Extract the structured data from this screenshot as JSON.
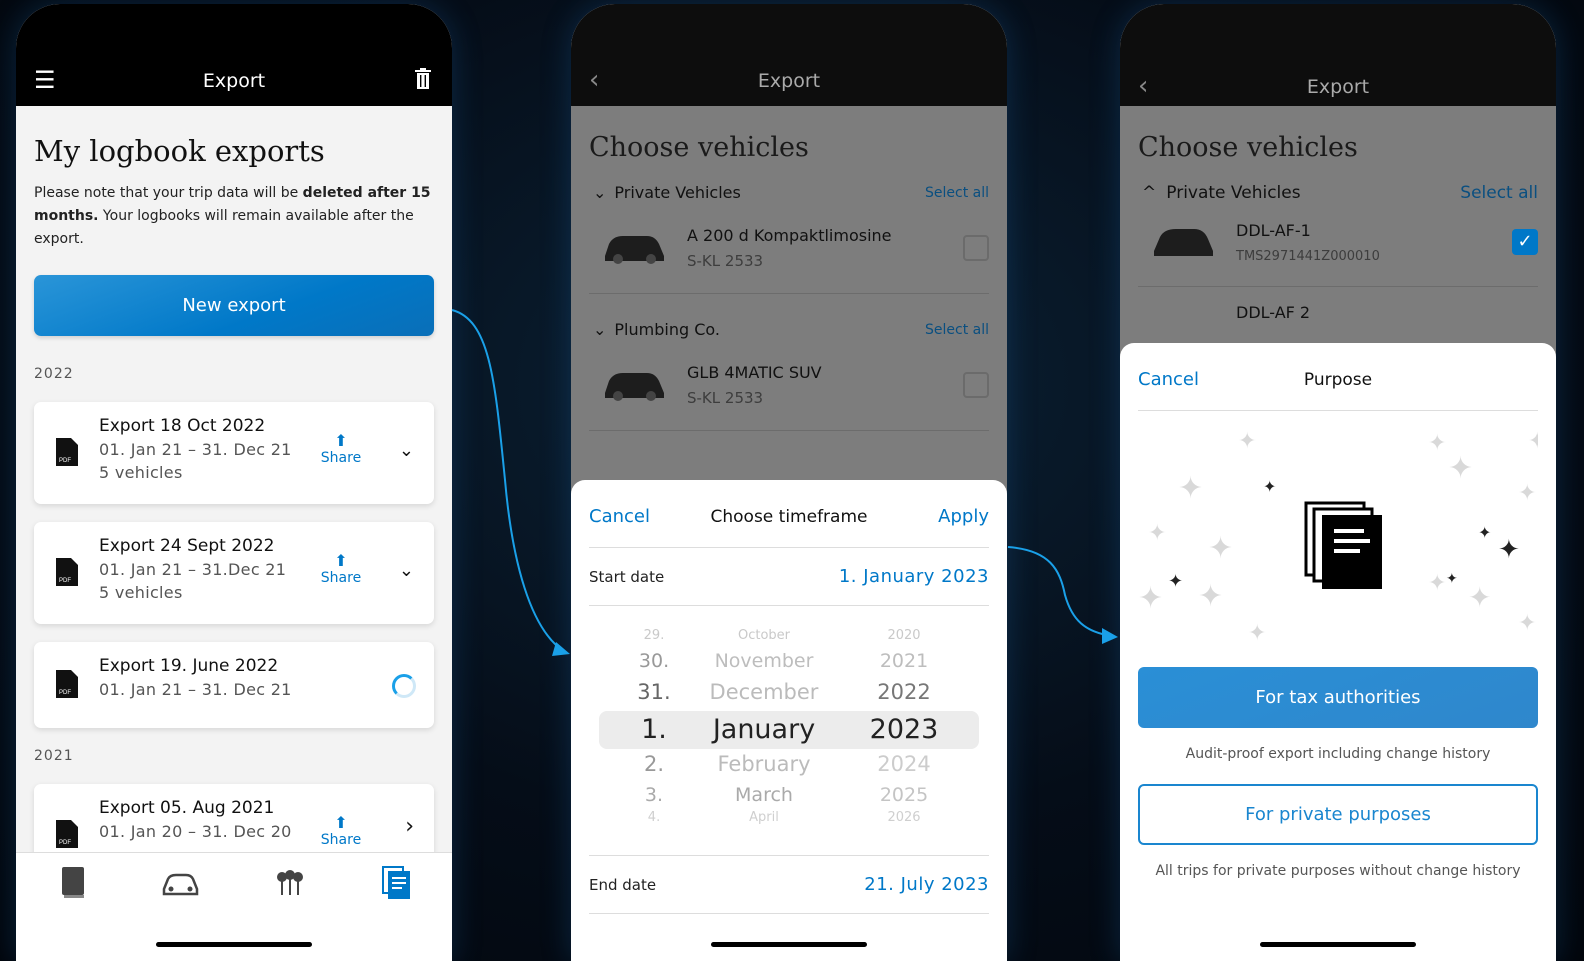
{
  "screen1": {
    "header_title": "Export",
    "page_title": "My logbook exports",
    "note_part1": "Please note that your trip data will be ",
    "note_bold": "deleted after 15 months.",
    "note_part2": " Your logbooks will remain available after the export.",
    "new_export_label": "New export",
    "year_2022": "2022",
    "year_2021": "2021",
    "exports": [
      {
        "title": "Export 18 Oct 2022",
        "range": "01. Jan 21 – 31. Dec 21",
        "vehicles": "5 vehicles",
        "share": "Share"
      },
      {
        "title": "Export 24 Sept 2022",
        "range": "01. Jan 21 – 31.Dec 21",
        "vehicles": "5 vehicles",
        "share": "Share"
      },
      {
        "title": "Export 19. June 2022",
        "range": "01. Jan 21 – 31. Dec 21"
      },
      {
        "title": "Export 05. Aug 2021",
        "range": "01. Jan 20 – 31. Dec 20",
        "share": "Share"
      }
    ],
    "pdf_label": "PDF"
  },
  "screen2": {
    "header_title": "Export",
    "page_title": "Choose vehicles",
    "groups": [
      {
        "name": "Private Vehicles",
        "select_all": "Select all",
        "vehicle": "A 200 d Kompaktlimosine",
        "plate": "S-KL 2533"
      },
      {
        "name": "Plumbing Co.",
        "select_all": "Select all",
        "vehicle": "GLB 4MATIC SUV",
        "plate": "S-KL 2533"
      }
    ],
    "sheet": {
      "cancel": "Cancel",
      "title": "Choose timeframe",
      "apply": "Apply",
      "start_label": "Start date",
      "start_value": "1. January 2023",
      "end_label": "End date",
      "end_value": "21. July 2023"
    },
    "picker_rows": [
      {
        "d": "29.",
        "m": "October",
        "y": "2020"
      },
      {
        "d": "30.",
        "m": "November",
        "y": "2021"
      },
      {
        "d": "31.",
        "m": "December",
        "y": "2022"
      },
      {
        "d": "1.",
        "m": "January",
        "y": "2023"
      },
      {
        "d": "2.",
        "m": "February",
        "y": "2024"
      },
      {
        "d": "3.",
        "m": "March",
        "y": "2025"
      },
      {
        "d": "4.",
        "m": "April",
        "y": "2026"
      }
    ]
  },
  "screen3": {
    "header_title": "Export",
    "page_title": "Choose vehicles",
    "group_name": "Private Vehicles",
    "select_all": "Select all",
    "vehicle1": "DDL-AF-1",
    "vin1": "TMS2971441Z000010",
    "vehicle2": "DDL-AF 2",
    "sheet": {
      "cancel": "Cancel",
      "title": "Purpose",
      "tax_btn": "For tax authorities",
      "tax_caption": "Audit-proof export including change history",
      "private_btn": "For private purposes",
      "private_caption": "All trips for private purposes without change history"
    }
  },
  "colors": {
    "accent": "#0078c8",
    "header_bg": "#000000"
  }
}
